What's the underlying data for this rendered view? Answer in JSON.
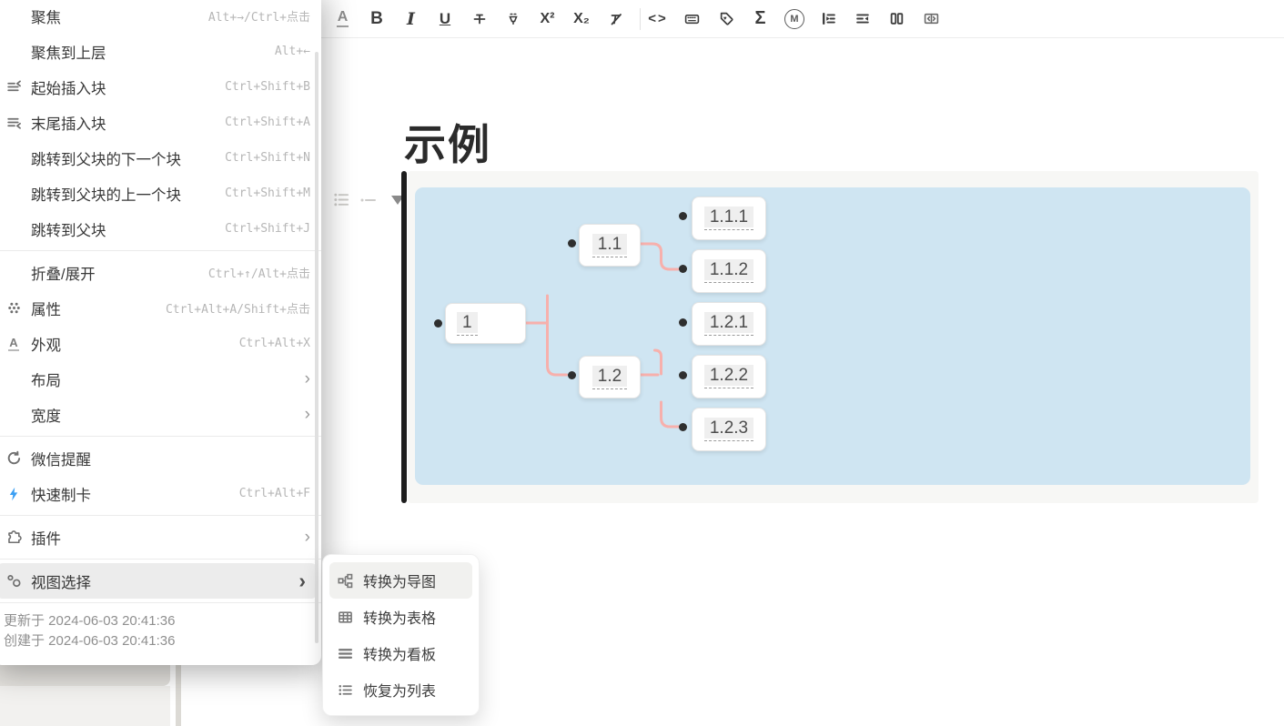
{
  "colors": {
    "accent_pink": "#f7b0ac",
    "canvas_blue": "#cfe5f2",
    "flash_blue": "#3b9ff3",
    "menu_highlight": "#ececec",
    "node_highlight": "#efefef",
    "bullet_dark": "#2f2f2f"
  },
  "ui": {
    "chevron": "›"
  },
  "toolbar": {
    "items": [
      {
        "name": "font-color",
        "glyph": "A"
      },
      {
        "name": "bold",
        "glyph": "B"
      },
      {
        "name": "italic",
        "glyph": "I"
      },
      {
        "name": "underline",
        "glyph": "U"
      },
      {
        "name": "strikethrough",
        "icon": "strikethrough-icon"
      },
      {
        "name": "highlight",
        "icon": "highlighter-icon"
      },
      {
        "name": "superscript",
        "glyph": "X²"
      },
      {
        "name": "subscript",
        "glyph": "X₂"
      },
      {
        "name": "clear-format",
        "icon": "clear-format-icon"
      },
      {
        "name": "inline-code",
        "glyph": "<>"
      },
      {
        "name": "keyboard",
        "icon": "keyboard-icon"
      },
      {
        "name": "tag",
        "icon": "tag-icon"
      },
      {
        "name": "inline-math",
        "glyph": "Σ"
      },
      {
        "name": "memo",
        "glyph": "M",
        "icon": "circled-m-icon"
      },
      {
        "name": "indent",
        "icon": "indent-icon"
      },
      {
        "name": "outdent",
        "icon": "outdent-icon"
      },
      {
        "name": "columns",
        "icon": "columns-icon"
      },
      {
        "name": "expand",
        "icon": "expand-icon"
      }
    ]
  },
  "menu": {
    "items": [
      {
        "label": "聚焦",
        "shortcut": "Alt+→/Ctrl+点击"
      },
      {
        "label": "聚焦到上层",
        "shortcut": "Alt+←"
      },
      {
        "label": "起始插入块",
        "shortcut": "Ctrl+Shift+B",
        "icon": "insert-start-icon"
      },
      {
        "label": "末尾插入块",
        "shortcut": "Ctrl+Shift+A",
        "icon": "insert-end-icon"
      },
      {
        "label": "跳转到父块的下一个块",
        "shortcut": "Ctrl+Shift+N"
      },
      {
        "label": "跳转到父块的上一个块",
        "shortcut": "Ctrl+Shift+M"
      },
      {
        "label": "跳转到父块",
        "shortcut": "Ctrl+Shift+J"
      },
      {
        "label": "折叠/展开",
        "shortcut": "Ctrl+↑/Alt+点击"
      },
      {
        "label": "属性",
        "shortcut": "Ctrl+Alt+A/Shift+点击",
        "icon": "attributes-dots-icon"
      },
      {
        "label": "外观",
        "shortcut": "Ctrl+Alt+X",
        "icon": "appearance-a-icon"
      },
      {
        "label": "布局",
        "has_submenu": true
      },
      {
        "label": "宽度",
        "has_submenu": true
      },
      {
        "label": "微信提醒",
        "icon": "refresh-circle-icon"
      },
      {
        "label": "快速制卡",
        "shortcut": "Ctrl+Alt+F",
        "icon": "lightning-bolt-icon"
      },
      {
        "label": "插件",
        "has_submenu": true,
        "icon": "puzzle-icon"
      },
      {
        "label": "视图选择",
        "has_submenu": true,
        "icon": "view-nodes-icon",
        "highlighted": true
      }
    ],
    "footer": {
      "updated": "更新于 2024-06-03 20:41:36",
      "created": "创建于 2024-06-03 20:41:36"
    }
  },
  "submenu": {
    "items": [
      {
        "label": "转换为导图",
        "icon": "mindmap-icon",
        "highlighted": true
      },
      {
        "label": "转换为表格",
        "icon": "table-icon"
      },
      {
        "label": "转换为看板",
        "icon": "kanban-icon"
      },
      {
        "label": "恢复为列表",
        "icon": "list-icon"
      }
    ]
  },
  "editor": {
    "title": "示例"
  },
  "mindmap": {
    "nodes": [
      {
        "label": "1"
      },
      {
        "label": "1.1"
      },
      {
        "label": "1.2"
      },
      {
        "label": "1.1.1"
      },
      {
        "label": "1.1.2"
      },
      {
        "label": "1.2.1"
      },
      {
        "label": "1.2.2"
      },
      {
        "label": "1.2.3"
      }
    ]
  }
}
